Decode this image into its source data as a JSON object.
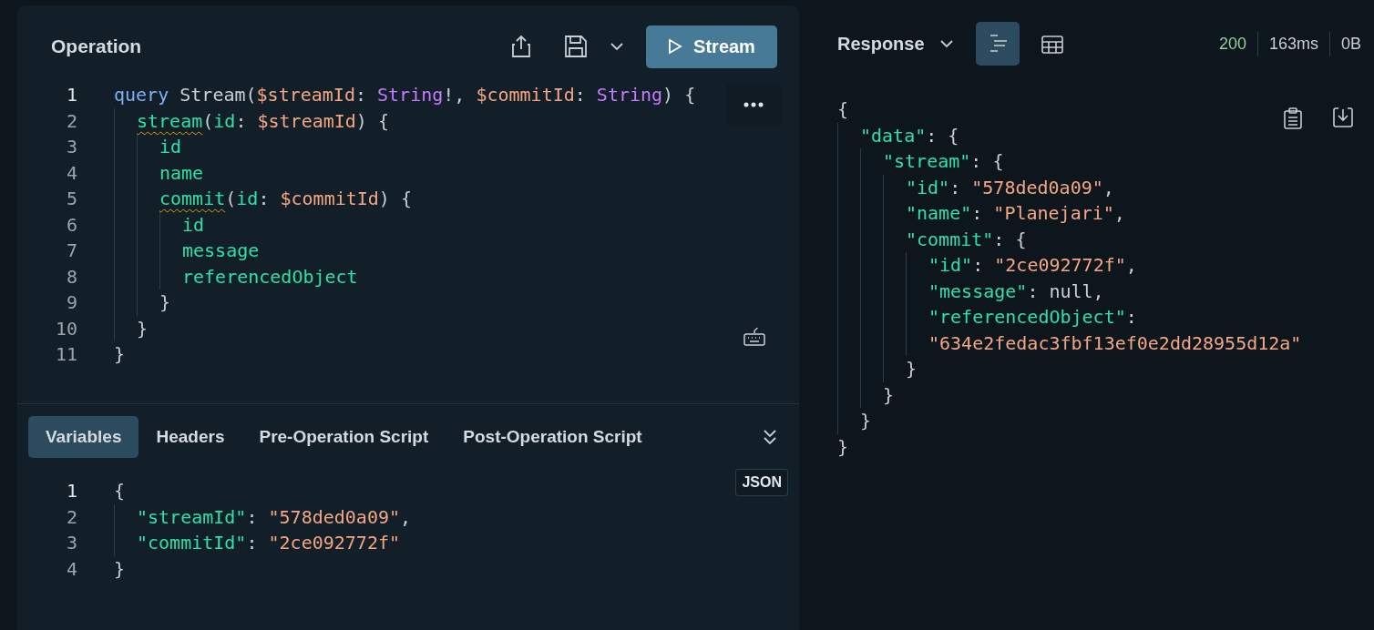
{
  "operation": {
    "title": "Operation",
    "run_button": "Stream",
    "editor": {
      "lines": [
        {
          "number": "1",
          "tokens": [
            {
              "kind": "keyword",
              "text": "query"
            },
            {
              "kind": "plain",
              "text": " Stream("
            },
            {
              "kind": "variable",
              "text": "$streamId"
            },
            {
              "kind": "plain",
              "text": ": "
            },
            {
              "kind": "type",
              "text": "String"
            },
            {
              "kind": "plain",
              "text": "!, "
            },
            {
              "kind": "variable",
              "text": "$commitId"
            },
            {
              "kind": "plain",
              "text": ": "
            },
            {
              "kind": "type",
              "text": "String"
            },
            {
              "kind": "plain",
              "text": ") {"
            }
          ],
          "children": [
            {
              "number": "2",
              "tokens": [
                {
                  "kind": "field_warning",
                  "text": "stream"
                },
                {
                  "kind": "plain",
                  "text": "("
                },
                {
                  "kind": "field",
                  "text": "id"
                },
                {
                  "kind": "plain",
                  "text": ": "
                },
                {
                  "kind": "variable",
                  "text": "$streamId"
                },
                {
                  "kind": "plain",
                  "text": ") {"
                }
              ],
              "children": [
                {
                  "number": "3",
                  "tokens": [
                    {
                      "kind": "field",
                      "text": "id"
                    }
                  ]
                },
                {
                  "number": "4",
                  "tokens": [
                    {
                      "kind": "field",
                      "text": "name"
                    }
                  ]
                },
                {
                  "number": "5",
                  "tokens": [
                    {
                      "kind": "field_warning",
                      "text": "commit"
                    },
                    {
                      "kind": "plain",
                      "text": "("
                    },
                    {
                      "kind": "field",
                      "text": "id"
                    },
                    {
                      "kind": "plain",
                      "text": ": "
                    },
                    {
                      "kind": "variable",
                      "text": "$commitId"
                    },
                    {
                      "kind": "plain",
                      "text": ") {"
                    }
                  ],
                  "children": [
                    {
                      "number": "6",
                      "tokens": [
                        {
                          "kind": "field",
                          "text": "id"
                        }
                      ]
                    },
                    {
                      "number": "7",
                      "tokens": [
                        {
                          "kind": "field",
                          "text": "message"
                        }
                      ]
                    },
                    {
                      "number": "8",
                      "tokens": [
                        {
                          "kind": "field",
                          "text": "referencedObject"
                        }
                      ]
                    }
                  ]
                },
                {
                  "number": "9",
                  "tokens": [
                    {
                      "kind": "plain",
                      "text": "}"
                    }
                  ]
                }
              ]
            },
            {
              "number": "10",
              "tokens": [
                {
                  "kind": "plain",
                  "text": "}"
                }
              ]
            }
          ]
        },
        {
          "number": "11",
          "tokens": [
            {
              "kind": "plain",
              "text": "}"
            }
          ]
        }
      ]
    }
  },
  "variables": {
    "tabs": [
      {
        "label": "Variables",
        "selected": true
      },
      {
        "label": "Headers",
        "selected": false
      },
      {
        "label": "Pre-Operation Script",
        "selected": false
      },
      {
        "label": "Post-Operation Script",
        "selected": false
      }
    ],
    "mode": "JSON",
    "lines": [
      {
        "number": "1",
        "tokens": [
          {
            "kind": "plain",
            "text": "{"
          }
        ],
        "children": [
          {
            "number": "2",
            "tokens": [
              {
                "kind": "field",
                "text": "\"streamId\""
              },
              {
                "kind": "plain",
                "text": ": "
              },
              {
                "kind": "string",
                "text": "\"578ded0a09\""
              },
              {
                "kind": "plain",
                "text": ","
              }
            ]
          },
          {
            "number": "3",
            "tokens": [
              {
                "kind": "field",
                "text": "\"commitId\""
              },
              {
                "kind": "plain",
                "text": ": "
              },
              {
                "kind": "string",
                "text": "\"2ce092772f\""
              }
            ]
          }
        ]
      },
      {
        "number": "4",
        "tokens": [
          {
            "kind": "plain",
            "text": "}"
          }
        ]
      }
    ]
  },
  "response": {
    "title": "Response",
    "views": [
      {
        "kind": "tree",
        "selected": true
      },
      {
        "kind": "table",
        "selected": false
      }
    ],
    "status": "200",
    "time": "163ms",
    "size": "0B",
    "lines": [
      {
        "tokens": [
          {
            "kind": "plain",
            "text": "{"
          }
        ],
        "children": [
          {
            "tokens": [
              {
                "kind": "field",
                "text": "\"data\""
              },
              {
                "kind": "plain",
                "text": ": {"
              }
            ],
            "children": [
              {
                "tokens": [
                  {
                    "kind": "field",
                    "text": "\"stream\""
                  },
                  {
                    "kind": "plain",
                    "text": ": {"
                  }
                ],
                "children": [
                  {
                    "tokens": [
                      {
                        "kind": "field",
                        "text": "\"id\""
                      },
                      {
                        "kind": "plain",
                        "text": ": "
                      },
                      {
                        "kind": "string",
                        "text": "\"578ded0a09\""
                      },
                      {
                        "kind": "plain",
                        "text": ","
                      }
                    ]
                  },
                  {
                    "tokens": [
                      {
                        "kind": "field",
                        "text": "\"name\""
                      },
                      {
                        "kind": "plain",
                        "text": ": "
                      },
                      {
                        "kind": "string",
                        "text": "\"Planejari\""
                      },
                      {
                        "kind": "plain",
                        "text": ","
                      }
                    ]
                  },
                  {
                    "tokens": [
                      {
                        "kind": "field",
                        "text": "\"commit\""
                      },
                      {
                        "kind": "plain",
                        "text": ": {"
                      }
                    ],
                    "children": [
                      {
                        "tokens": [
                          {
                            "kind": "field",
                            "text": "\"id\""
                          },
                          {
                            "kind": "plain",
                            "text": ": "
                          },
                          {
                            "kind": "string",
                            "text": "\"2ce092772f\""
                          },
                          {
                            "kind": "plain",
                            "text": ","
                          }
                        ]
                      },
                      {
                        "tokens": [
                          {
                            "kind": "field",
                            "text": "\"message\""
                          },
                          {
                            "kind": "plain",
                            "text": ": null,"
                          }
                        ]
                      },
                      {
                        "tokens": [
                          {
                            "kind": "field",
                            "text": "\"referencedObject\""
                          },
                          {
                            "kind": "plain",
                            "text": ":"
                          }
                        ]
                      },
                      {
                        "tokens": [
                          {
                            "kind": "string",
                            "text": "\"634e2fedac3fbf13ef0e2dd28955d12a\""
                          }
                        ]
                      }
                    ]
                  },
                  {
                    "tokens": [
                      {
                        "kind": "plain",
                        "text": "}"
                      }
                    ]
                  }
                ]
              },
              {
                "tokens": [
                  {
                    "kind": "plain",
                    "text": "}"
                  }
                ]
              }
            ]
          },
          {
            "tokens": [
              {
                "kind": "plain",
                "text": "}"
              }
            ]
          }
        ]
      },
      {
        "tokens": [
          {
            "kind": "plain",
            "text": "}"
          }
        ]
      }
    ]
  }
}
